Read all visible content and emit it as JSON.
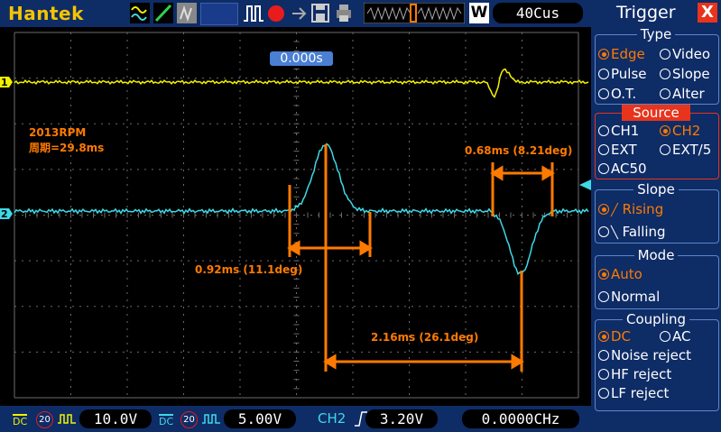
{
  "header": {
    "brand": "Hantek",
    "trigger_position": "0.000s",
    "timebase": "40Cus",
    "mode_letter": "W"
  },
  "annotations": {
    "rpm": "2013RPM",
    "period": "周期=29.8ms",
    "pulse1": "0.92ms (11.1deg)",
    "pulse2": "0.68ms (8.21deg)",
    "gap": "2.16ms (26.1deg)"
  },
  "channels": {
    "ch1_marker": "1",
    "ch2_marker": "2",
    "ch1_color": "#f2f200",
    "ch2_color": "#3fd9e6",
    "annotation_color": "#ff7a00"
  },
  "bottom": {
    "ch1_coupling": "DC",
    "ch1_bw": "20",
    "ch1_volts": "10.0V",
    "ch2_coupling": "DC",
    "ch2_bw": "20",
    "ch2_volts": "5.00V",
    "trig_source": "CH2",
    "trig_level": "3.20V",
    "frequency": "0.0000CHz"
  },
  "panel": {
    "title": "Trigger",
    "close": "X",
    "type_title": "Type",
    "type_options": [
      "Edge",
      "Video",
      "Pulse",
      "Slope",
      "O.T.",
      "Alter"
    ],
    "source_title": "Source",
    "source_options": [
      "CH1",
      "CH2",
      "EXT",
      "EXT/5",
      "AC50"
    ],
    "slope_title": "Slope",
    "slope_options": [
      "Rising",
      "Falling"
    ],
    "mode_title": "Mode",
    "mode_options": [
      "Auto",
      "Normal"
    ],
    "coupling_title": "Coupling",
    "coupling_options": [
      "DC",
      "AC",
      "Noise reject",
      "HF reject",
      "LF reject"
    ]
  }
}
